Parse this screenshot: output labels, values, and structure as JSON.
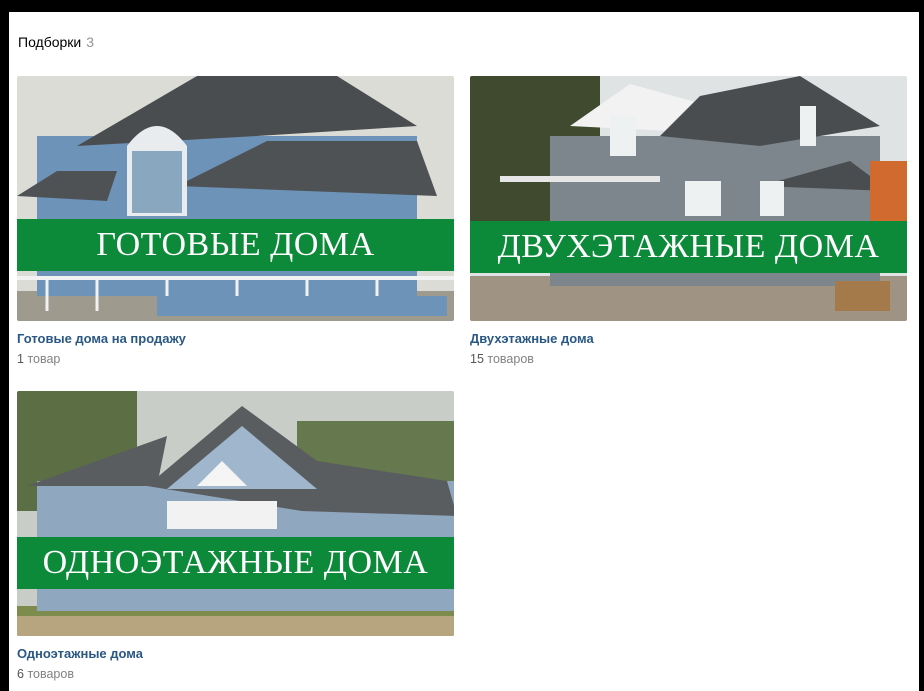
{
  "header": {
    "title": "Подборки",
    "count": "3"
  },
  "collections": [
    {
      "banner": "ГОТОВЫЕ ДОМА",
      "title": "Готовые дома на продажу",
      "count_num": "1",
      "count_word": "товар"
    },
    {
      "banner": "ДВУХЭТАЖНЫЕ ДОМА",
      "title": "Двухэтажные дома",
      "count_num": "15",
      "count_word": "товаров"
    },
    {
      "banner": "ОДНОЭТАЖНЫЕ ДОМА",
      "title": "Одноэтажные дома",
      "count_num": "6",
      "count_word": "товаров"
    }
  ],
  "colors": {
    "banner_green": "#0c8a3a",
    "link_blue": "#2a5885",
    "muted_gray": "#828282"
  }
}
